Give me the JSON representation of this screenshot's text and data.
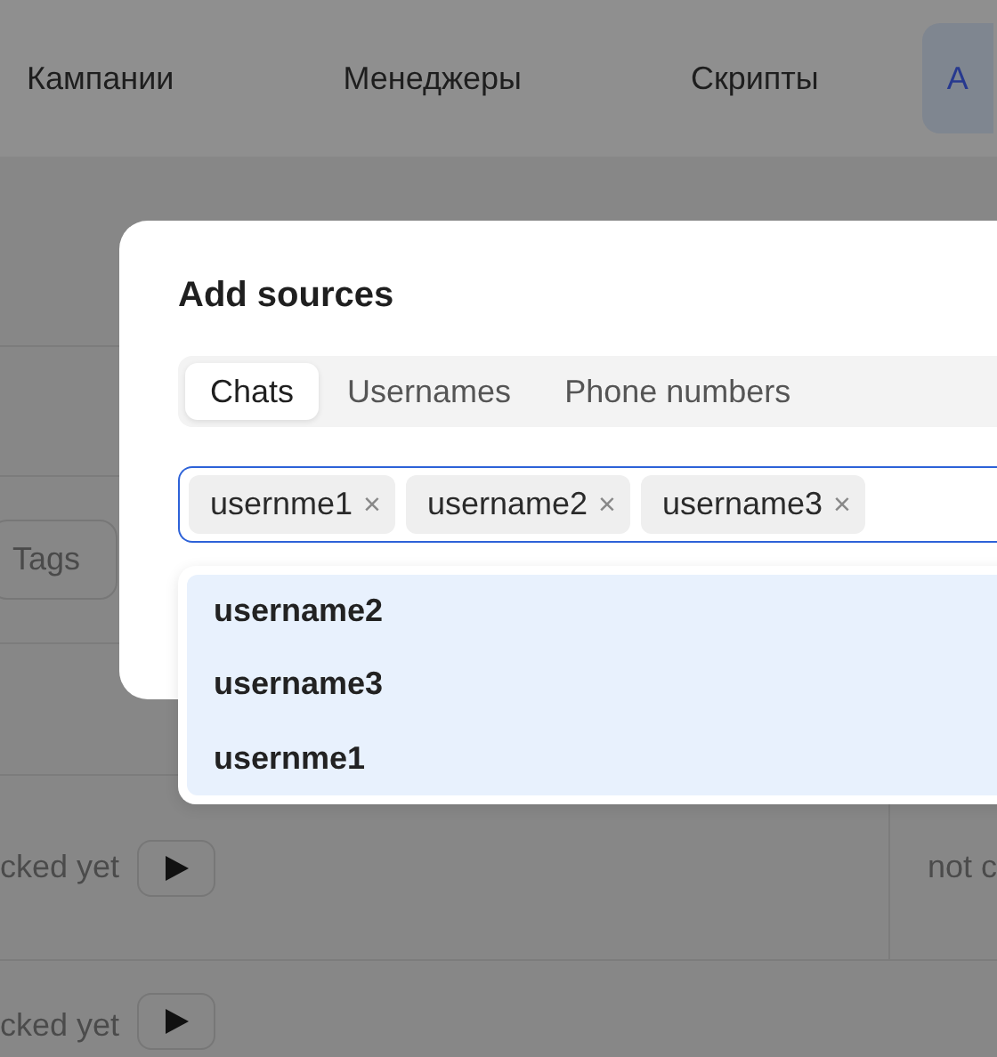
{
  "nav": {
    "tabs": [
      {
        "label": "Кампании",
        "selected": false
      },
      {
        "label": "Менеджеры",
        "selected": false
      },
      {
        "label": "Скрипты",
        "selected": false
      },
      {
        "label": "А",
        "selected": true
      }
    ]
  },
  "background": {
    "filter_button": "Tags",
    "rows": [
      {
        "status": "cked yet",
        "column_2": "not c"
      },
      {
        "status": "cked yet"
      }
    ]
  },
  "modal": {
    "title": "Add sources",
    "tabs": [
      {
        "label": "Chats",
        "selected": true
      },
      {
        "label": "Usernames",
        "selected": false
      },
      {
        "label": "Phone numbers",
        "selected": false
      }
    ],
    "field": {
      "focused": true,
      "chips": [
        {
          "label": "usernme1",
          "remove": "×"
        },
        {
          "label": "username2",
          "remove": "×"
        },
        {
          "label": "username3",
          "remove": "×"
        }
      ]
    },
    "suggestions": [
      {
        "label": "username2"
      },
      {
        "label": "username3"
      },
      {
        "label": "usernme1"
      }
    ]
  }
}
